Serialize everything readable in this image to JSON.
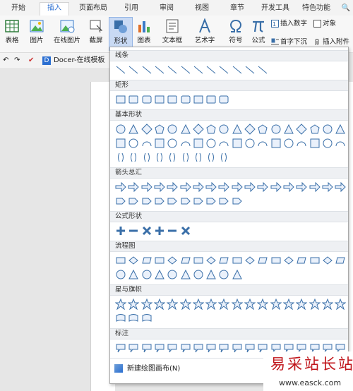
{
  "tabs": [
    "开始",
    "插入",
    "页面布局",
    "引用",
    "审阅",
    "视图",
    "章节",
    "开发工具",
    "特色功能",
    "🔍"
  ],
  "ribbon": {
    "table": "表格",
    "picture": "图片",
    "online_picture": "在线图片",
    "screenshot": "截屏",
    "shape": "形状",
    "chart": "图表",
    "textbox": "文本框",
    "wordart": "艺术字",
    "symbol": "符号",
    "formula": "公式",
    "insert_number": "插入数字",
    "object": "对象",
    "dropcap": "首字下沉",
    "attachment": "插入附件"
  },
  "quickbar": {
    "docer": "Docer-在线模板"
  },
  "panel": {
    "categories": [
      "线条",
      "矩形",
      "基本形状",
      "箭头总汇",
      "公式形状",
      "流程图",
      "星与旗帜",
      "标注"
    ],
    "new_canvas": "新建绘图画布(N)"
  },
  "watermark": {
    "text": "易采站长站",
    "url": "www.easck.com"
  },
  "colors": {
    "accent": "#2b6fd1",
    "shape_stroke": "#3a6fa8",
    "shape_fill": "#eaf1fb",
    "watermark": "#c0161b"
  }
}
